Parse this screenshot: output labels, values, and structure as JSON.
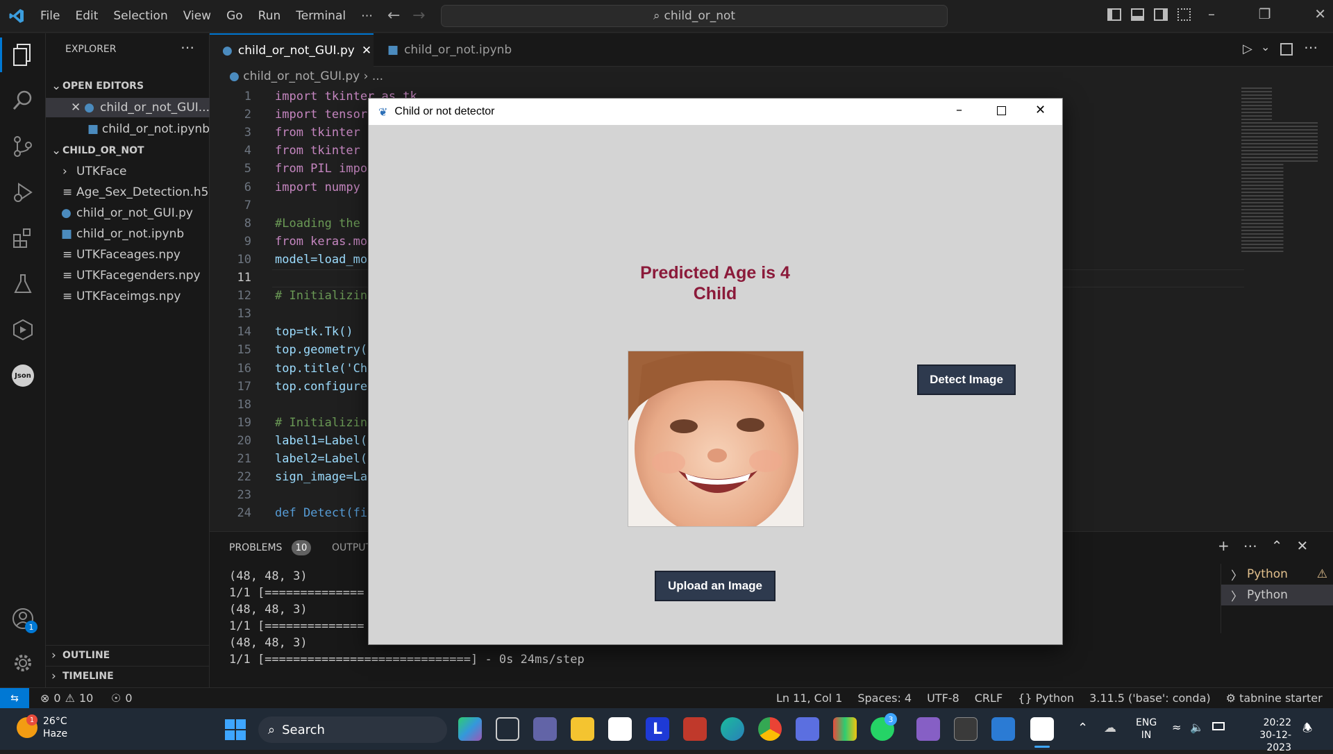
{
  "menu": [
    "File",
    "Edit",
    "Selection",
    "View",
    "Go",
    "Run",
    "Terminal",
    "⋯"
  ],
  "search": "child_or_not",
  "sidebar": {
    "title": "EXPLORER",
    "open_editors_label": "OPEN EDITORS",
    "open_editors": [
      "child_or_not_GUI...",
      "child_or_not.ipynb"
    ],
    "folder_label": "CHILD_OR_NOT",
    "files": [
      "UTKFace",
      "Age_Sex_Detection.h5",
      "child_or_not_GUI.py",
      "child_or_not.ipynb",
      "UTKFaceages.npy",
      "UTKFacegenders.npy",
      "UTKFaceimgs.npy"
    ],
    "outline": "OUTLINE",
    "timeline": "TIMELINE"
  },
  "tabs": [
    "child_or_not_GUI.py",
    "child_or_not.ipynb"
  ],
  "breadcrumb": [
    "child_or_not_GUI.py",
    "..."
  ],
  "code": {
    "line_numbers": [
      "1",
      "2",
      "3",
      "4",
      "5",
      "6",
      "7",
      "8",
      "9",
      "10",
      "11",
      "12",
      "13",
      "14",
      "15",
      "16",
      "17",
      "18",
      "19",
      "20",
      "21",
      "22",
      "23",
      "24"
    ],
    "lines": [
      "import tkinter as tk",
      "import tensor",
      "from tkinter",
      "from tkinter",
      "from PIL impo",
      "import numpy",
      "",
      "#Loading the",
      "from keras.mo",
      "model=load_mo",
      "",
      "# Initializin",
      "",
      "top=tk.Tk()",
      "top.geometry(",
      "top.title('Ch",
      "top.configure",
      "",
      "# Initializin",
      "label1=Label(",
      "label2=Label(",
      "sign_image=La",
      "",
      "def Detect(fi"
    ]
  },
  "panel": {
    "problems_label": "PROBLEMS",
    "problems_count": "10",
    "output_label": "OUTPUT",
    "terminal_lines": [
      "(48, 48, 3)",
      "1/1 [==============",
      "(48, 48, 3)",
      "1/1 [==============",
      "(48, 48, 3)",
      "1/1 [=============================] - 0s 24ms/step"
    ],
    "terminals": [
      "Python",
      "Python"
    ]
  },
  "status": {
    "errors": "0",
    "warnings": "10",
    "ports": "0",
    "position": "Ln 11, Col 1",
    "spaces": "Spaces: 4",
    "encoding": "UTF-8",
    "eol": "CRLF",
    "language": "Python",
    "interpreter": "3.11.5 ('base': conda)",
    "tabnine": "tabnine starter"
  },
  "dialog": {
    "title": "Child or not detector",
    "prediction_line1": "Predicted Age is 4",
    "prediction_line2": "Child",
    "detect_button": "Detect Image",
    "upload_button": "Upload an Image",
    "accent_color": "#8b1a3a"
  },
  "taskbar": {
    "weather_temp": "26°C",
    "weather_desc": "Haze",
    "weather_badge": "1",
    "search": "Search",
    "language": "ENG",
    "region": "IN",
    "time": "20:22",
    "date": "30-12-2023",
    "whatsapp_badge": "3"
  },
  "accounts_badge": "1"
}
